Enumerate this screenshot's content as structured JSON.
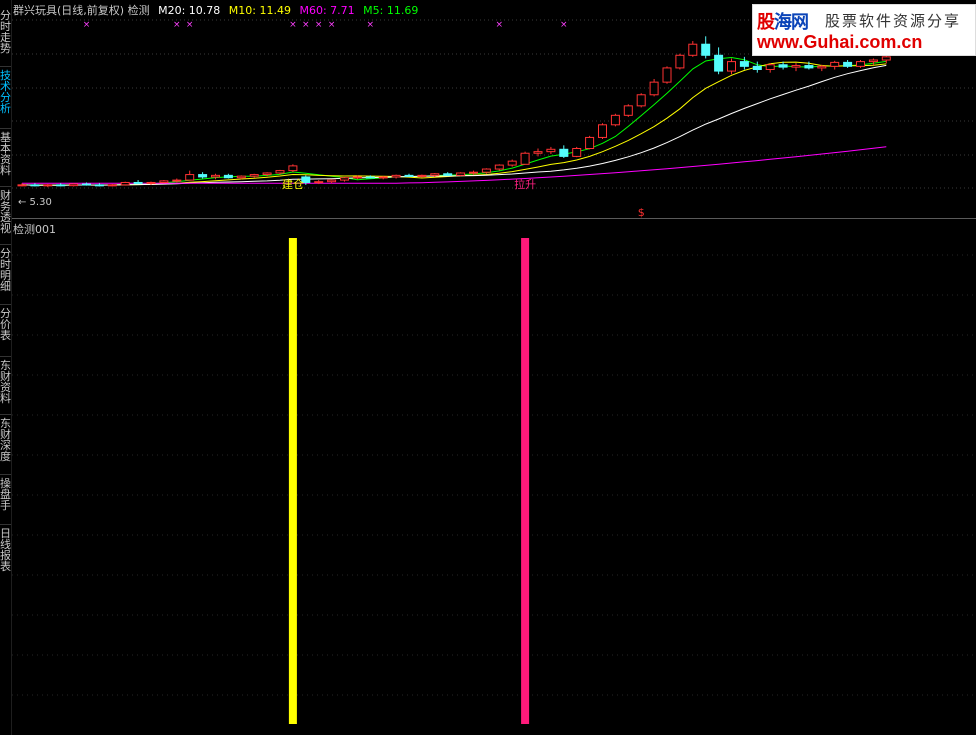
{
  "sidebar": {
    "tabs": [
      {
        "label": "分时走势",
        "active": false
      },
      {
        "label": "技术分析",
        "active": true
      },
      {
        "label": "基本资料",
        "active": false
      },
      {
        "label": "财务透视",
        "active": false
      },
      {
        "label": "分时明细",
        "active": false
      },
      {
        "label": "分价表",
        "active": false
      },
      {
        "label": "东财资料",
        "active": false
      },
      {
        "label": "东财深度",
        "active": false
      },
      {
        "label": "操盘手",
        "active": false
      },
      {
        "label": "日线报表",
        "active": false
      }
    ]
  },
  "header": {
    "title": "群兴玩具(日线,前复权) 检测",
    "indicators": [
      {
        "text": "M20: 10.78",
        "color": "#ffffff"
      },
      {
        "text": "M10: 11.49",
        "color": "#ffff00"
      },
      {
        "text": "M60: 7.71",
        "color": "#ff00ff"
      },
      {
        "text": "M5: 11.69",
        "color": "#00ff00"
      }
    ]
  },
  "logo": {
    "brand_a": "股",
    "brand_b": "海网",
    "slogan": "股票软件资源分享",
    "url": "www.Guhai.com.cn"
  },
  "chart_data": [
    {
      "type": "candlestick",
      "price_label": "5.30",
      "annotations": [
        {
          "text": "建仓",
          "color": "#ffff00",
          "x_index": 21
        },
        {
          "text": "拉升",
          "color": "#ff2080",
          "x_index": 39
        }
      ],
      "signal_marker": {
        "text": "$",
        "color": "#ff3030",
        "x_index": 48
      },
      "x_markers": [
        5,
        12,
        13,
        21,
        22,
        23,
        24,
        27,
        37,
        42
      ],
      "candles": [
        [
          5.5,
          5.6,
          5.4,
          5.5
        ],
        [
          5.5,
          5.6,
          5.4,
          5.45
        ],
        [
          5.45,
          5.55,
          5.35,
          5.5
        ],
        [
          5.5,
          5.6,
          5.4,
          5.45
        ],
        [
          5.45,
          5.6,
          5.4,
          5.55
        ],
        [
          5.55,
          5.65,
          5.45,
          5.5
        ],
        [
          5.5,
          5.6,
          5.4,
          5.45
        ],
        [
          5.45,
          5.55,
          5.4,
          5.5
        ],
        [
          5.5,
          5.7,
          5.45,
          5.65
        ],
        [
          5.65,
          5.8,
          5.55,
          5.6
        ],
        [
          5.6,
          5.7,
          5.5,
          5.65
        ],
        [
          5.65,
          5.8,
          5.6,
          5.75
        ],
        [
          5.75,
          5.9,
          5.65,
          5.8
        ],
        [
          5.8,
          6.4,
          5.9,
          6.15
        ],
        [
          6.15,
          6.3,
          5.9,
          6.0
        ],
        [
          6.0,
          6.2,
          5.85,
          6.1
        ],
        [
          6.1,
          6.2,
          5.9,
          5.95
        ],
        [
          5.95,
          6.1,
          5.85,
          6.05
        ],
        [
          6.05,
          6.2,
          5.95,
          6.15
        ],
        [
          6.15,
          6.3,
          6.05,
          6.25
        ],
        [
          6.25,
          6.45,
          6.15,
          6.4
        ],
        [
          6.4,
          6.8,
          6.3,
          6.7
        ],
        [
          6.0,
          6.1,
          5.5,
          5.65
        ],
        [
          5.65,
          5.8,
          5.55,
          5.7
        ],
        [
          5.7,
          5.85,
          5.6,
          5.8
        ],
        [
          5.8,
          6.0,
          5.7,
          5.95
        ],
        [
          5.95,
          6.1,
          5.85,
          6.0
        ],
        [
          6.0,
          6.1,
          5.9,
          5.95
        ],
        [
          5.95,
          6.05,
          5.85,
          6.0
        ],
        [
          6.0,
          6.15,
          5.9,
          6.1
        ],
        [
          6.1,
          6.2,
          6.0,
          6.05
        ],
        [
          6.05,
          6.15,
          5.95,
          6.1
        ],
        [
          6.1,
          6.25,
          6.0,
          6.2
        ],
        [
          6.2,
          6.3,
          6.05,
          6.1
        ],
        [
          6.1,
          6.3,
          6.05,
          6.25
        ],
        [
          6.25,
          6.4,
          6.15,
          6.3
        ],
        [
          6.3,
          6.55,
          6.2,
          6.5
        ],
        [
          6.5,
          6.8,
          6.4,
          6.75
        ],
        [
          6.75,
          7.1,
          6.65,
          7.0
        ],
        [
          6.8,
          7.6,
          6.8,
          7.5
        ],
        [
          7.5,
          7.8,
          7.3,
          7.6
        ],
        [
          7.6,
          7.9,
          7.45,
          7.75
        ],
        [
          7.75,
          8.0,
          7.2,
          7.3
        ],
        [
          7.3,
          7.9,
          7.25,
          7.8
        ],
        [
          7.8,
          8.6,
          7.75,
          8.5
        ],
        [
          8.5,
          9.4,
          8.4,
          9.3
        ],
        [
          9.3,
          10.0,
          9.2,
          9.9
        ],
        [
          9.9,
          10.6,
          9.8,
          10.5
        ],
        [
          10.5,
          11.3,
          10.4,
          11.2
        ],
        [
          11.2,
          12.2,
          11.1,
          12.0
        ],
        [
          12.0,
          13.0,
          11.9,
          12.9
        ],
        [
          12.9,
          13.8,
          12.8,
          13.7
        ],
        [
          13.7,
          14.6,
          13.6,
          14.4
        ],
        [
          14.4,
          14.9,
          13.5,
          13.7
        ],
        [
          13.7,
          14.2,
          12.5,
          12.7
        ],
        [
          12.7,
          13.5,
          12.5,
          13.3
        ],
        [
          13.3,
          13.6,
          12.8,
          13.0
        ],
        [
          13.0,
          13.3,
          12.6,
          12.8
        ],
        [
          12.8,
          13.2,
          12.6,
          13.1
        ],
        [
          13.1,
          13.3,
          12.8,
          12.95
        ],
        [
          12.95,
          13.2,
          12.7,
          13.05
        ],
        [
          13.05,
          13.3,
          12.8,
          12.9
        ],
        [
          12.9,
          13.1,
          12.7,
          13.0
        ],
        [
          13.0,
          13.35,
          12.8,
          13.25
        ],
        [
          13.25,
          13.4,
          12.9,
          13.0
        ],
        [
          13.0,
          13.4,
          12.9,
          13.3
        ],
        [
          13.3,
          13.5,
          13.1,
          13.4
        ],
        [
          13.4,
          13.7,
          13.2,
          13.6
        ]
      ],
      "ma_series": [
        {
          "name": "M5",
          "color": "#00ff00"
        },
        {
          "name": "M10",
          "color": "#ffff00"
        },
        {
          "name": "M20",
          "color": "#ffffff"
        },
        {
          "name": "M60",
          "color": "#ff00ff"
        }
      ]
    },
    {
      "type": "bar",
      "title": "检测001",
      "bars": [
        {
          "x_index": 21,
          "value": 1,
          "color": "#ffff00"
        },
        {
          "x_index": 39,
          "value": 1,
          "color": "#ff1a7a"
        }
      ]
    }
  ]
}
